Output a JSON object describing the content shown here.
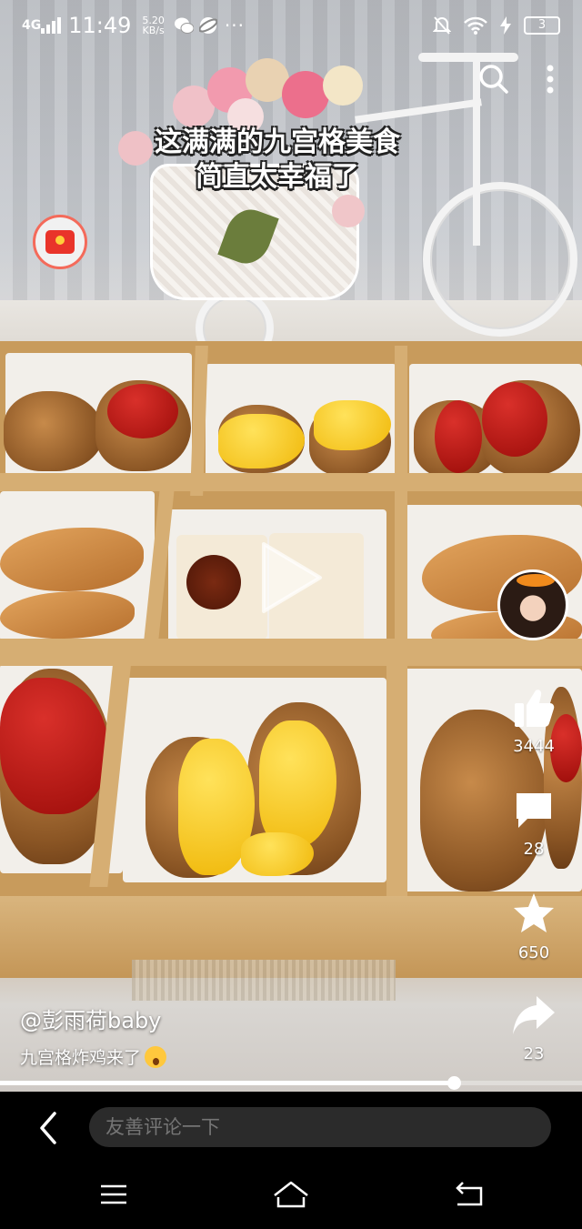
{
  "status_bar": {
    "network": "4G",
    "time": "11:49",
    "speed_value": "5.20",
    "speed_unit": "KB/s",
    "battery": "3"
  },
  "video": {
    "overlay_title_line1": "这满满的九宫格美食",
    "overlay_title_line2": "简直太幸福了",
    "progress": 0.78
  },
  "actions": {
    "likes": "3444",
    "comments": "28",
    "favorites": "650",
    "shares": "23"
  },
  "post": {
    "author": "@彭雨荷baby",
    "caption": "九宫格炸鸡来了"
  },
  "comment_bar": {
    "placeholder": "友善评论一下"
  },
  "icons": {
    "search": "search-icon",
    "more": "more-vertical-icon",
    "red_packet": "red-packet-icon",
    "play": "play-icon",
    "like": "thumbs-up-icon",
    "comment": "comment-bubble-icon",
    "favorite": "star-icon",
    "share": "share-arrow-icon",
    "back": "chevron-left-icon",
    "nav_menu": "menu-icon",
    "nav_home": "home-icon",
    "nav_back": "back-icon"
  }
}
